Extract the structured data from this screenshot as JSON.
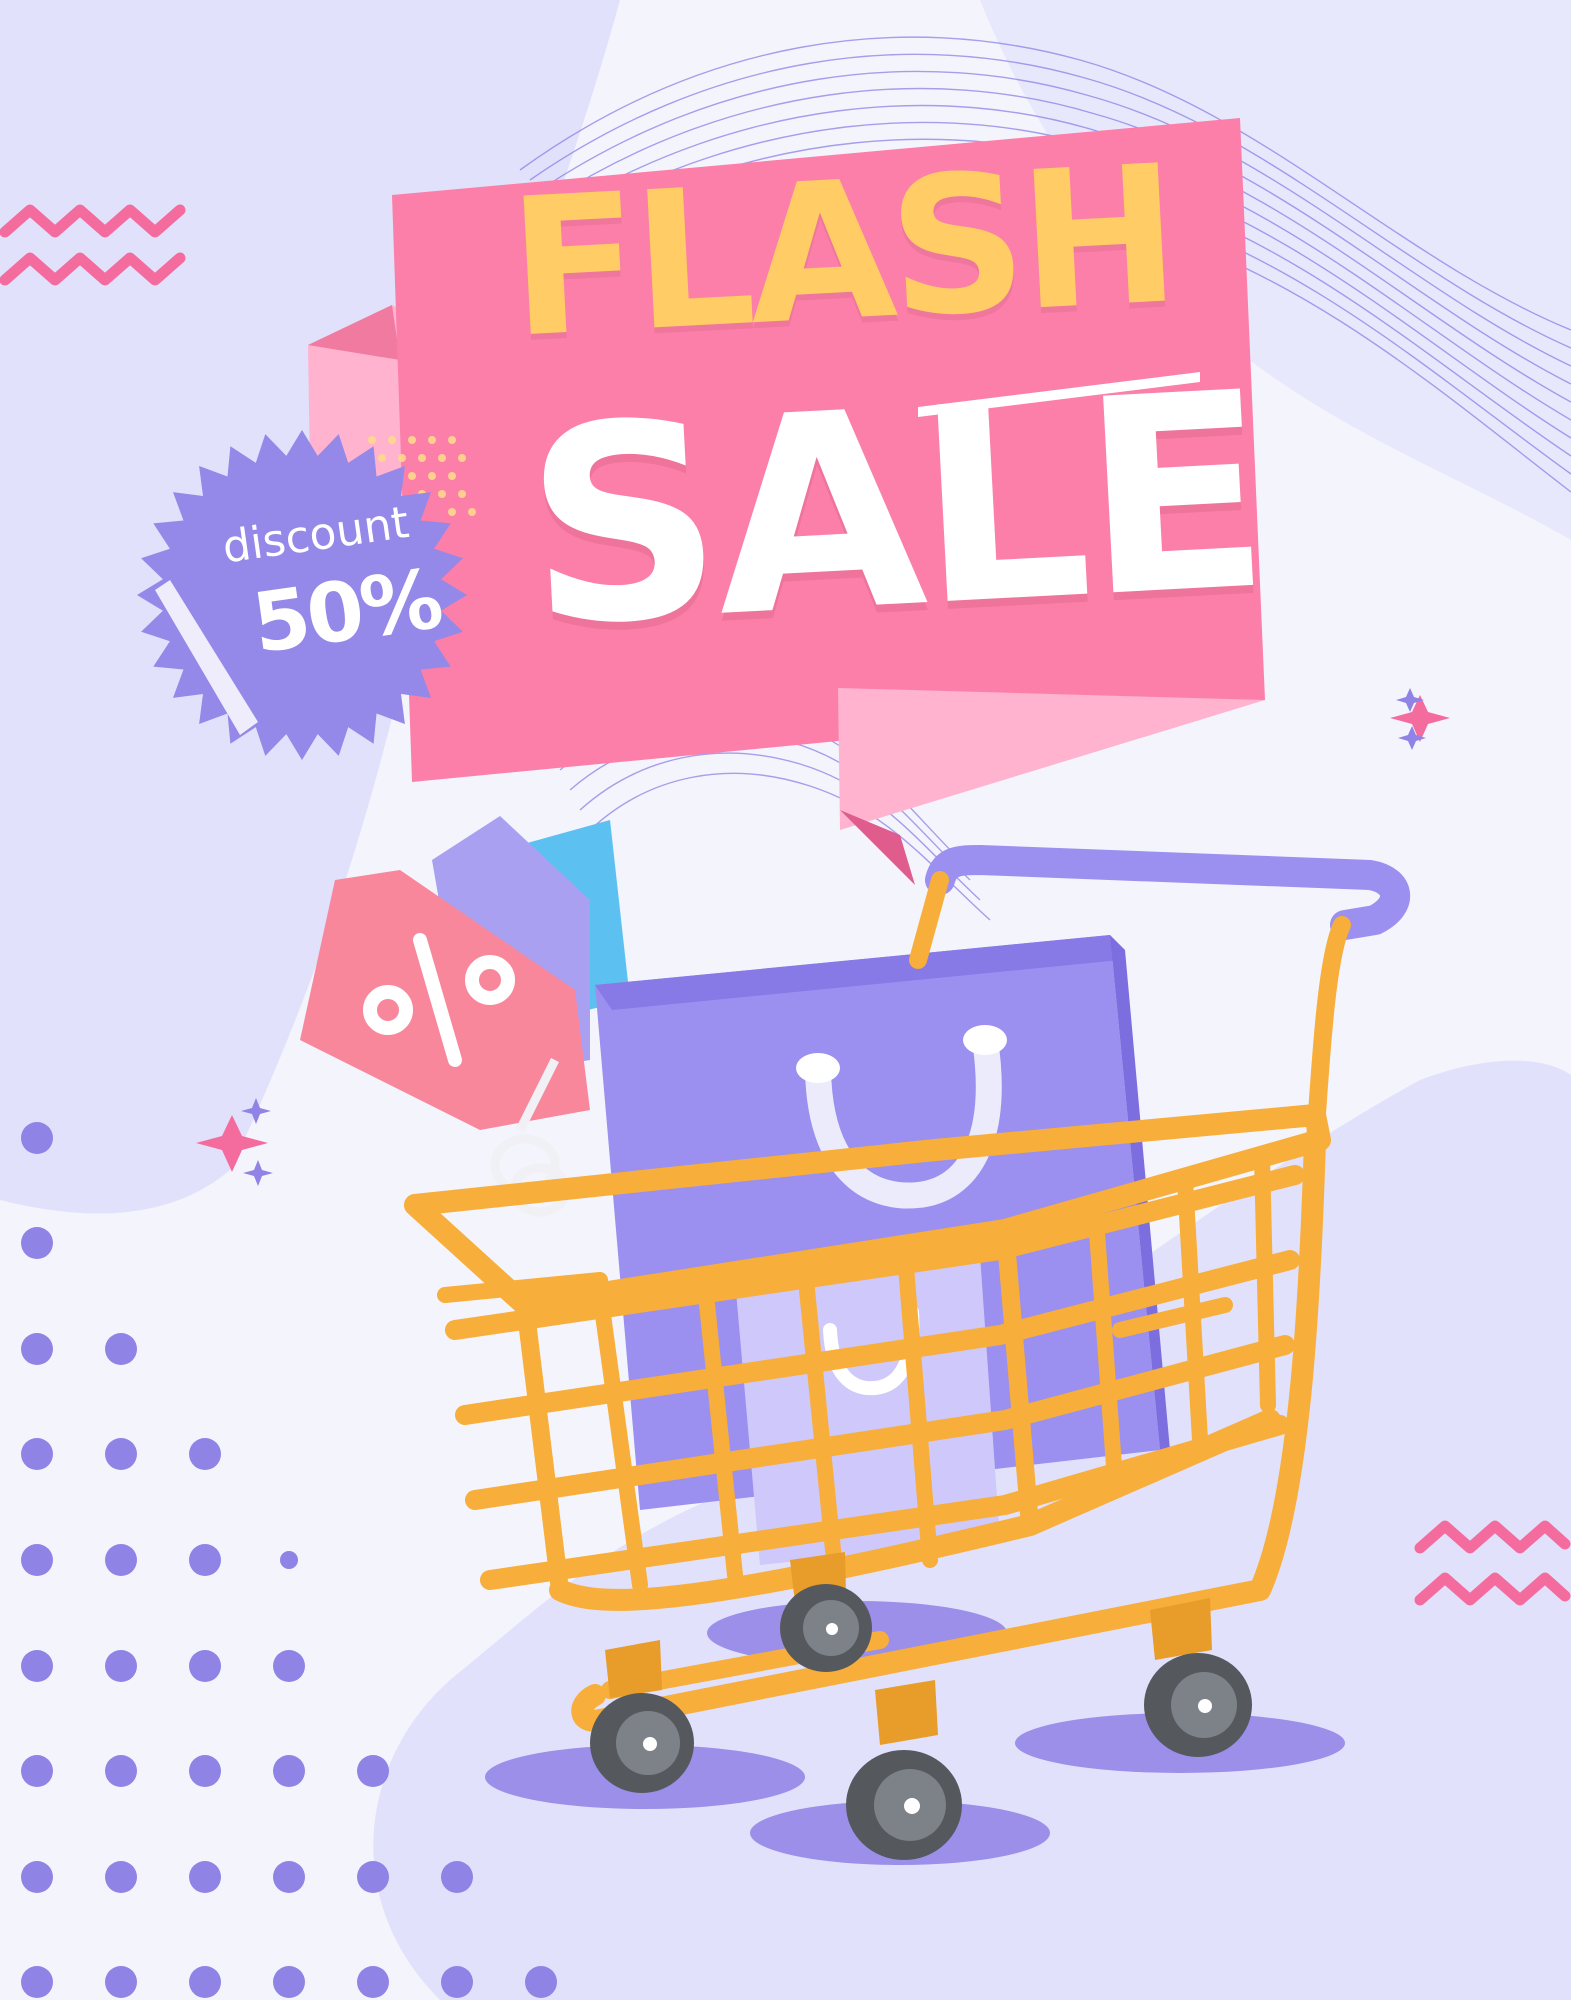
{
  "banner": {
    "headline_top": "FLASH",
    "headline_bottom": "SALE"
  },
  "badge": {
    "label": "discount",
    "value": "50%"
  },
  "colors": {
    "background": "#f4f4fd",
    "blob_lavender": "#e1e1fb",
    "banner_pink": "#fc7fa9",
    "ribbon_light_pink": "#ffb3cf",
    "headline_yellow": "#ffcc66",
    "badge_purple": "#9488e8",
    "bag_purple": "#9b8ff0",
    "cart_orange": "#f7ae3a",
    "accent_pink": "#f46b9e",
    "dot_purple": "#8f83e6"
  }
}
